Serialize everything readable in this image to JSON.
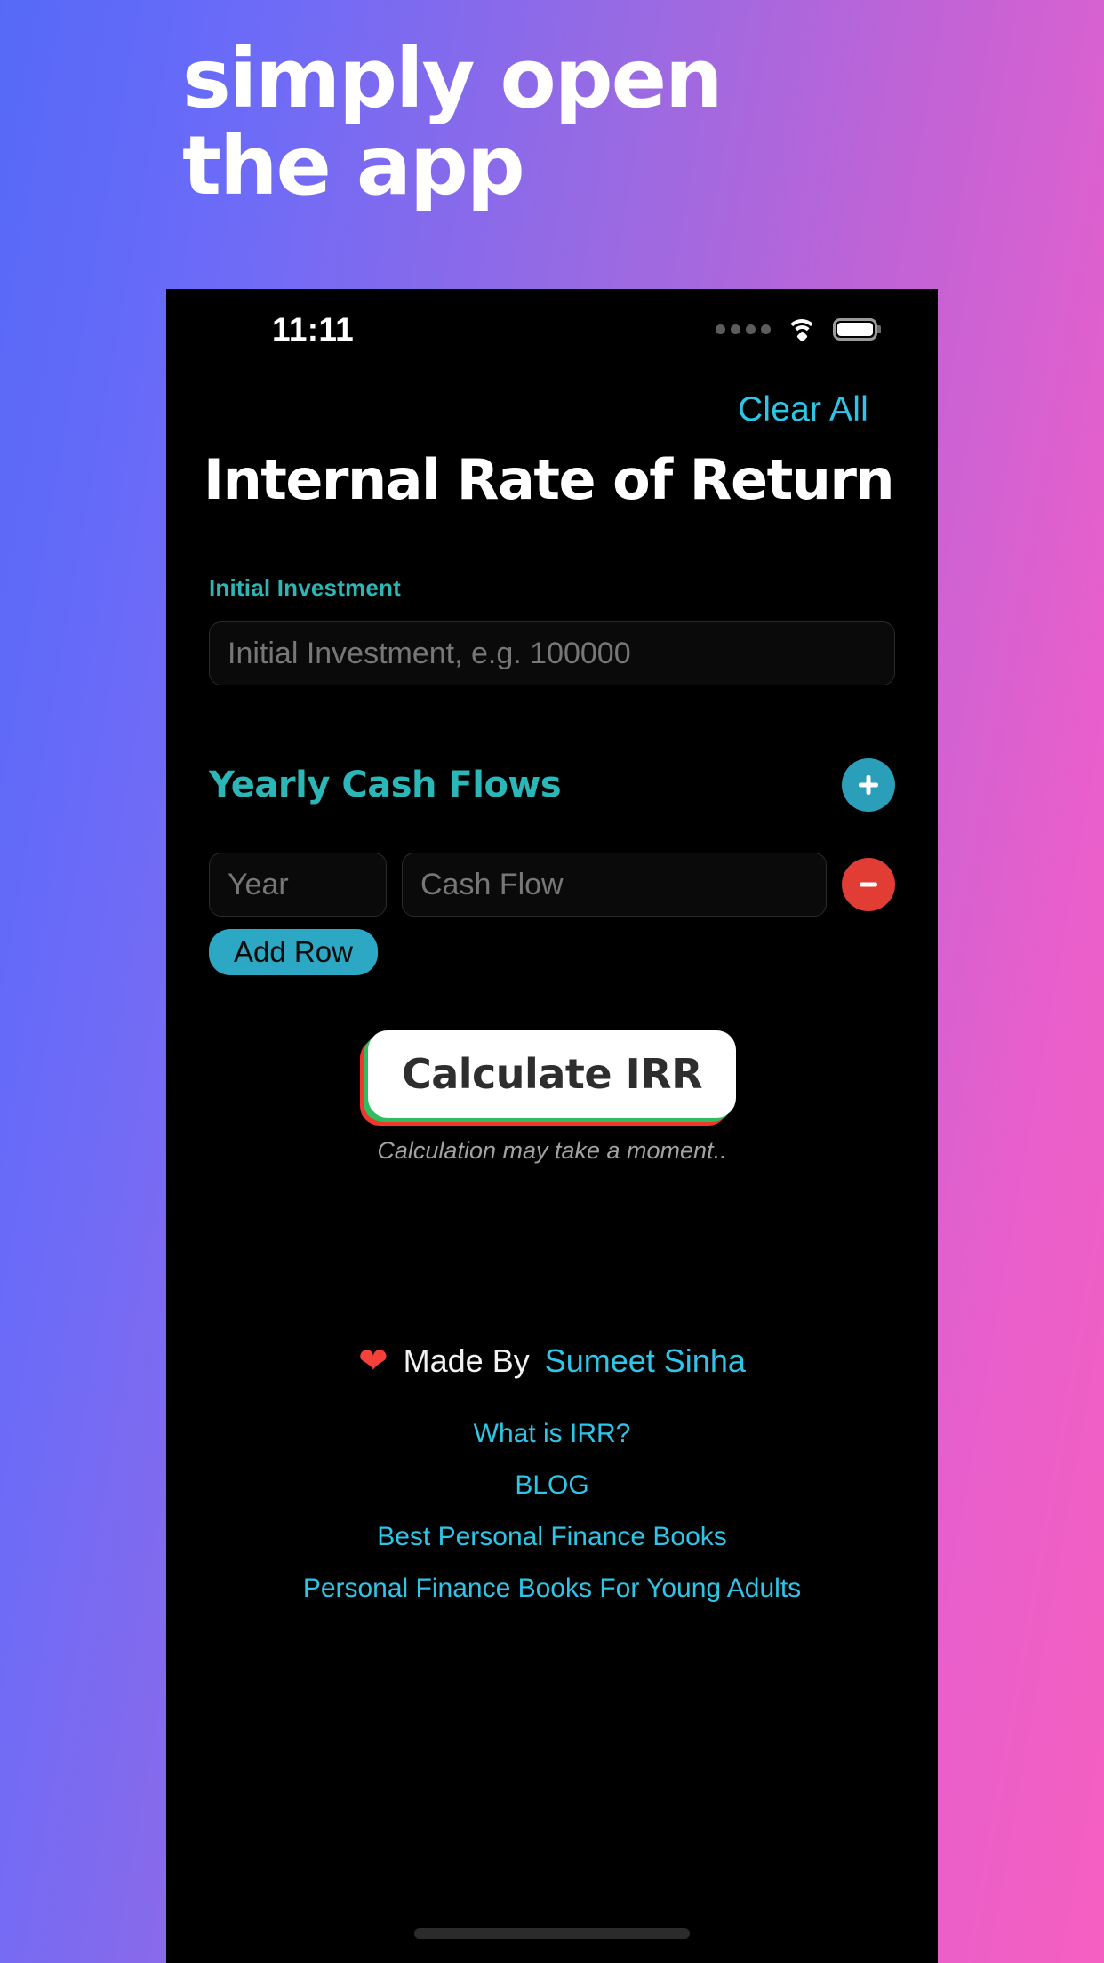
{
  "promo": {
    "line1": "simply open",
    "line2": "the app"
  },
  "statusbar": {
    "time": "11:11",
    "signal_icon": "signal-dots-icon",
    "wifi_icon": "wifi-icon",
    "battery_icon": "battery-icon"
  },
  "app": {
    "clear_all_label": "Clear All",
    "title": "Internal Rate of Return",
    "initial_investment": {
      "label": "Initial Investment",
      "placeholder": "Initial Investment, e.g. 100000",
      "value": ""
    },
    "cash_flows": {
      "title": "Yearly Cash Flows",
      "add_icon": "plus-icon",
      "remove_icon": "minus-icon",
      "rows": [
        {
          "year_placeholder": "Year",
          "year_value": "",
          "flow_placeholder": "Cash Flow",
          "flow_value": ""
        }
      ],
      "add_row_label": "Add Row"
    },
    "calculate": {
      "button_label": "Calculate IRR",
      "note": "Calculation may take a moment..",
      "shadow_red": "#f0372c",
      "shadow_green": "#2fbd5f"
    },
    "footer": {
      "heart_icon": "heart-icon",
      "made_by_label": "Made By",
      "author": "Sumeet Sinha",
      "links": [
        "What is IRR?",
        "BLOG",
        "Best Personal Finance Books",
        "Personal Finance Books For Young Adults"
      ]
    }
  },
  "colors": {
    "accent_cyan": "#2ec5e8",
    "accent_teal": "#2bb7b7",
    "danger_red": "#e13d34",
    "gradient_start": "#5569F7",
    "gradient_end": "#F55FC0"
  }
}
